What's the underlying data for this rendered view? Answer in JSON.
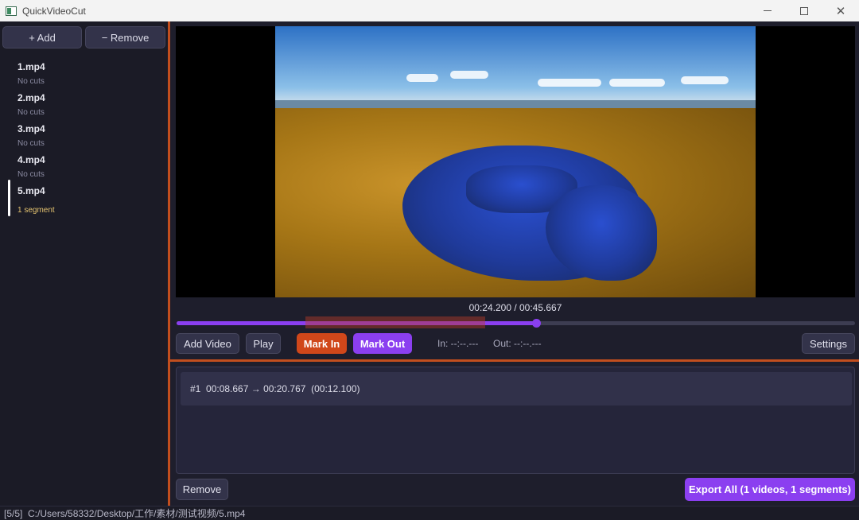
{
  "window": {
    "title": "QuickVideoCut"
  },
  "sidebar": {
    "add_label": "+ Add",
    "remove_label": "− Remove",
    "files": [
      {
        "name": "1.mp4",
        "sub": "No cuts"
      },
      {
        "name": "2.mp4",
        "sub": "No cuts"
      },
      {
        "name": "3.mp4",
        "sub": "No cuts"
      },
      {
        "name": "4.mp4",
        "sub": "No cuts"
      },
      {
        "name": "5.mp4",
        "sub": "1 segment"
      }
    ]
  },
  "player": {
    "time_readout": "00:24.200 / 00:45.667",
    "progress_fraction": 0.53,
    "segment_start_fraction": 0.19,
    "segment_end_fraction": 0.455
  },
  "controls": {
    "add_video": "Add Video",
    "play": "Play",
    "mark_in": "Mark In",
    "mark_out": "Mark Out",
    "in_readout": "In: --:--.---",
    "out_readout": "Out: --:--.---",
    "settings": "Settings"
  },
  "segments": [
    {
      "text": "#1  00:08.667 → 00:20.767  (00:12.100)"
    }
  ],
  "bottom": {
    "remove": "Remove",
    "export": "Export All (1 videos, 1 segments)"
  },
  "status": {
    "text": "[5/5]  C:/Users/58332/Desktop/工作/素材/测试视频/5.mp4"
  },
  "colors": {
    "accent_purple": "#8b3ff0",
    "accent_orange": "#d0471a",
    "splitter": "#c24e1e"
  }
}
